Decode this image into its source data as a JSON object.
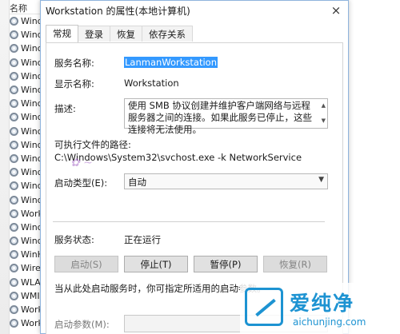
{
  "background_list": {
    "header": "名称",
    "rows": [
      "Wind",
      "Wind",
      "Wind",
      "Wind",
      "Wind",
      "Wind",
      "Wind",
      "Wind",
      "Wind",
      "Wind",
      "Wind",
      "Wind",
      "Wind",
      "Wind",
      "Work",
      "Wind",
      "Wind",
      "WinH",
      "Wire",
      "WLAI",
      "WMI",
      "Work",
      "Work"
    ]
  },
  "dialog": {
    "title": "Workstation 的属性(本地计算机)",
    "close_glyph": "×",
    "tabs": [
      "常规",
      "登录",
      "恢复",
      "依存关系"
    ],
    "active_tab": "常规",
    "fields": {
      "service_name_label": "服务名称:",
      "service_name": "LanmanWorkstation",
      "display_name_label": "显示名称:",
      "display_name": "Workstation",
      "description_label": "描述:",
      "description": "使用 SMB 协议创建并维护客户端网络与远程服务器之间的连接。如果此服务已停止，这些连接将无法使用。",
      "exe_path_label": "可执行文件的路径:",
      "exe_path": "C:\\Windows\\System32\\svchost.exe -k NetworkService",
      "startup_type_label": "启动类型(E):",
      "startup_type": "自动",
      "status_label": "服务状态:",
      "status": "正在运行",
      "start_hint": "当从此处启动服务时，你可指定所适用的启动参数。",
      "params_label": "启动参数(M):"
    },
    "buttons": {
      "start": "启动(S)",
      "stop": "停止(T)",
      "pause": "暂停(P)",
      "resume": "恢复(R)"
    }
  },
  "watermark": {
    "logo_text": "爱纯净",
    "logo_url": "aichunjing.com"
  }
}
